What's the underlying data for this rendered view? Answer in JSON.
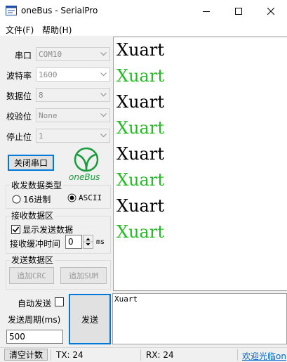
{
  "window": {
    "title": "oneBus - SerialPro"
  },
  "menu": {
    "file": "文件(F)",
    "help": "帮助(H)"
  },
  "settings": {
    "port_label": "串口",
    "port_value": "COM10",
    "baud_label": "波特率",
    "baud_value": "1600",
    "databits_label": "数据位",
    "databits_value": "8",
    "parity_label": "校验位",
    "parity_value": "None",
    "stopbits_label": "停止位",
    "stopbits_value": "1",
    "close_port_button": "关闭串口",
    "logo_text": "oneBus"
  },
  "data_type": {
    "title": "收发数据类型",
    "hex_label": "16进制",
    "ascii_label": "ASCII",
    "selected": "ASCII"
  },
  "receive_group": {
    "title": "接收数据区",
    "show_sent_label": "显示发送数据",
    "show_sent_checked": true,
    "buffer_time_label": "接收缓冲时间",
    "buffer_time_value": "0",
    "buffer_unit": "ms"
  },
  "send_group": {
    "title": "发送数据区",
    "add_crc": "追加CRC",
    "add_sum": "追加SUM"
  },
  "send_controls": {
    "auto_send_label": "自动发送",
    "period_label": "发送周期(ms)",
    "period_value": "500",
    "send_button": "发送"
  },
  "receive_lines": [
    {
      "text": "Xuart",
      "color": "#000000"
    },
    {
      "text": "Xuart",
      "color": "#22bb22"
    },
    {
      "text": "Xuart",
      "color": "#000000"
    },
    {
      "text": "Xuart",
      "color": "#22bb22"
    },
    {
      "text": "Xuart",
      "color": "#000000"
    },
    {
      "text": "Xuart",
      "color": "#22bb22"
    },
    {
      "text": "Xuart",
      "color": "#000000"
    },
    {
      "text": "Xuart",
      "color": "#22bb22"
    }
  ],
  "transmit_text": "Xuart",
  "status": {
    "clear_button": "清空计数",
    "tx": "TX: 24",
    "rx": "RX: 24",
    "welcome_link": "欢迎光临on"
  },
  "colors": {
    "accent": "#0078d7",
    "sent_green": "#22bb22",
    "logo_green": "#1a9c3a"
  }
}
